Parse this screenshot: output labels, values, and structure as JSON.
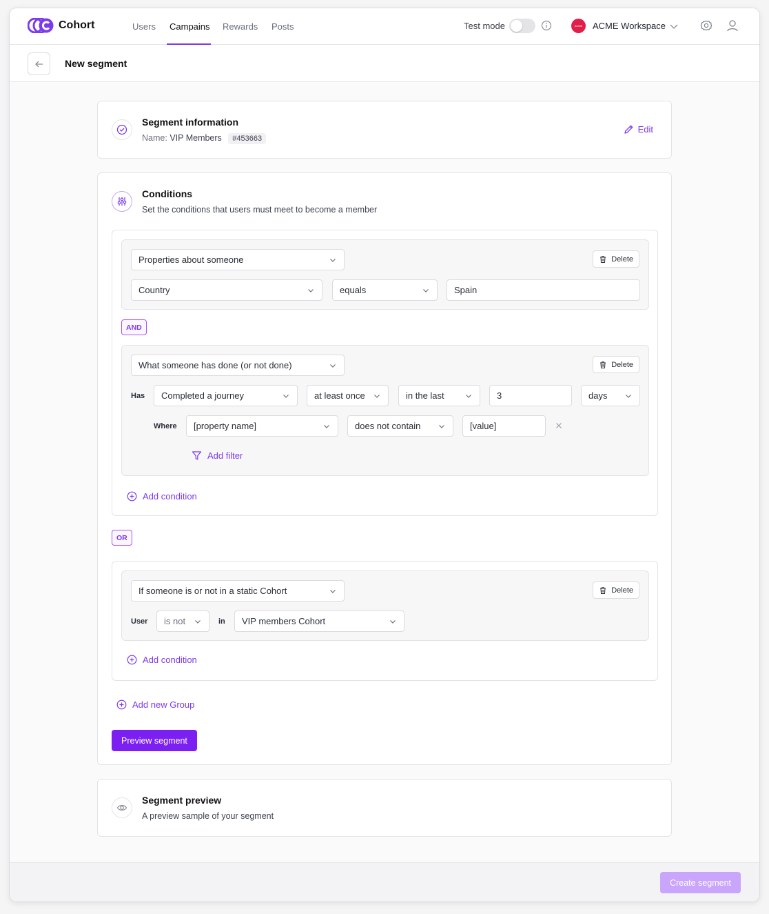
{
  "brand": {
    "name": "Cohort",
    "accent": "#7c3aed"
  },
  "nav": {
    "tabs": [
      {
        "label": "Users"
      },
      {
        "label": "Campains"
      },
      {
        "label": "Rewards"
      },
      {
        "label": "Posts"
      }
    ],
    "active_tab": "Campains",
    "test_mode_label": "Test mode",
    "test_mode_on": false,
    "workspace": {
      "logo_text": "ACME",
      "name": "ACME Workspace"
    }
  },
  "header": {
    "title": "New segment"
  },
  "segment_info": {
    "title": "Segment information",
    "name_label": "Name:",
    "name_value": "VIP Members",
    "id": "#453663",
    "edit_label": "Edit"
  },
  "conditions": {
    "title": "Conditions",
    "subtitle": "Set the conditions that users must meet to become a member",
    "group1": {
      "cond1": {
        "type": "Properties about someone",
        "delete_label": "Delete",
        "property": "Country",
        "operator": "equals",
        "value": "Spain"
      },
      "and_label": "AND",
      "cond2": {
        "type": "What someone has done (or not done)",
        "delete_label": "Delete",
        "has_label": "Has",
        "event": "Completed a journey",
        "frequency": "at least once",
        "timeframe": "in the last",
        "amount": "3",
        "unit": "days",
        "where_label": "Where",
        "filter_property": "[property name]",
        "filter_operator": "does not contain",
        "filter_value": "[value]",
        "add_filter_label": "Add filter"
      },
      "add_condition_label": "Add condition"
    },
    "or_label": "OR",
    "group2": {
      "cond1": {
        "type": "If someone is or not in a static Cohort",
        "delete_label": "Delete",
        "user_label": "User",
        "membership": "is not",
        "in_label": "in",
        "cohort": "VIP members Cohort"
      },
      "add_condition_label": "Add condition"
    },
    "add_group_label": "Add new Group",
    "preview_button": "Preview segment"
  },
  "segment_preview": {
    "title": "Segment preview",
    "subtitle": "A preview sample of your segment"
  },
  "footer": {
    "create_button": "Create segment"
  }
}
